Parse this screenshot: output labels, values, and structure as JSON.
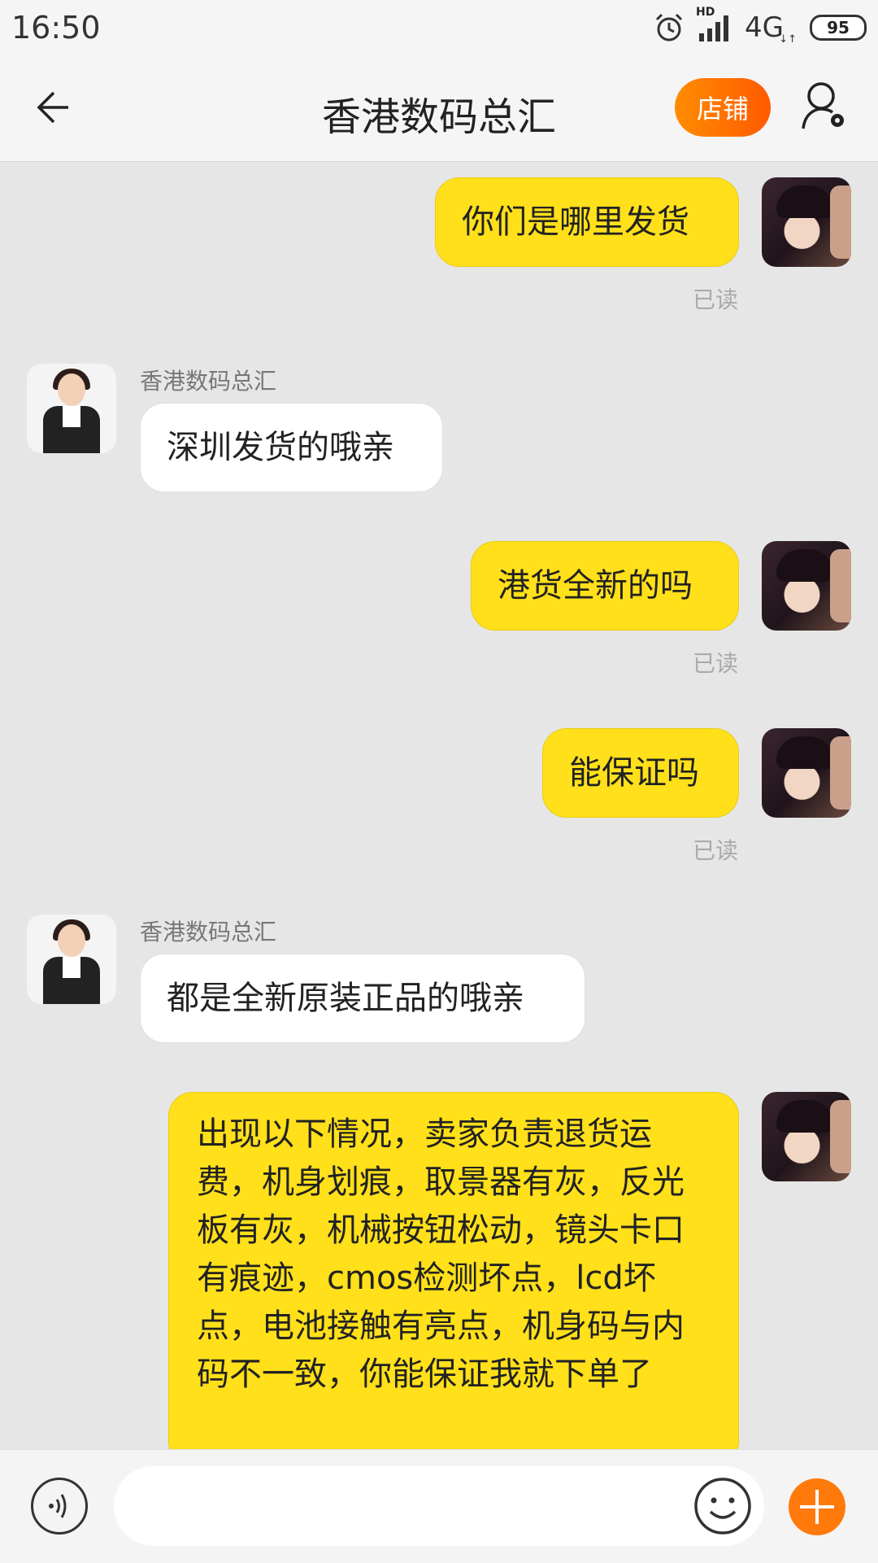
{
  "status_bar": {
    "time": "16:50",
    "network": "4G",
    "hd": "HD",
    "battery": "95"
  },
  "header": {
    "title": "香港数码总汇",
    "shop_label": "店铺"
  },
  "messages": [
    {
      "from": "me",
      "text": "你们是哪里发货",
      "status": "已读"
    },
    {
      "from": "shop",
      "sender": "香港数码总汇",
      "text": "深圳发货的哦亲"
    },
    {
      "from": "me",
      "text": "港货全新的吗",
      "status": "已读"
    },
    {
      "from": "me",
      "text": "能保证吗",
      "status": "已读"
    },
    {
      "from": "shop",
      "sender": "香港数码总汇",
      "text": "都是全新原装正品的哦亲"
    },
    {
      "from": "me",
      "text": "出现以下情况，卖家负责退货运费，机身划痕，取景器有灰，反光板有灰，机械按钮松动，镜头卡口有痕迹，cmos检测坏点，lcd坏点，电池接触有亮点，机身码与内码不一致，你能保证我就下单了"
    }
  ],
  "colors": {
    "my_bubble": "#ffe01a",
    "shop_bubble": "#ffffff",
    "accent": "#ff7a0a",
    "background": "#e6e6e6"
  },
  "input_bar": {
    "voice_icon": "voice-icon",
    "emoji_icon": "emoji-icon",
    "plus_icon": "plus-icon",
    "value": ""
  }
}
